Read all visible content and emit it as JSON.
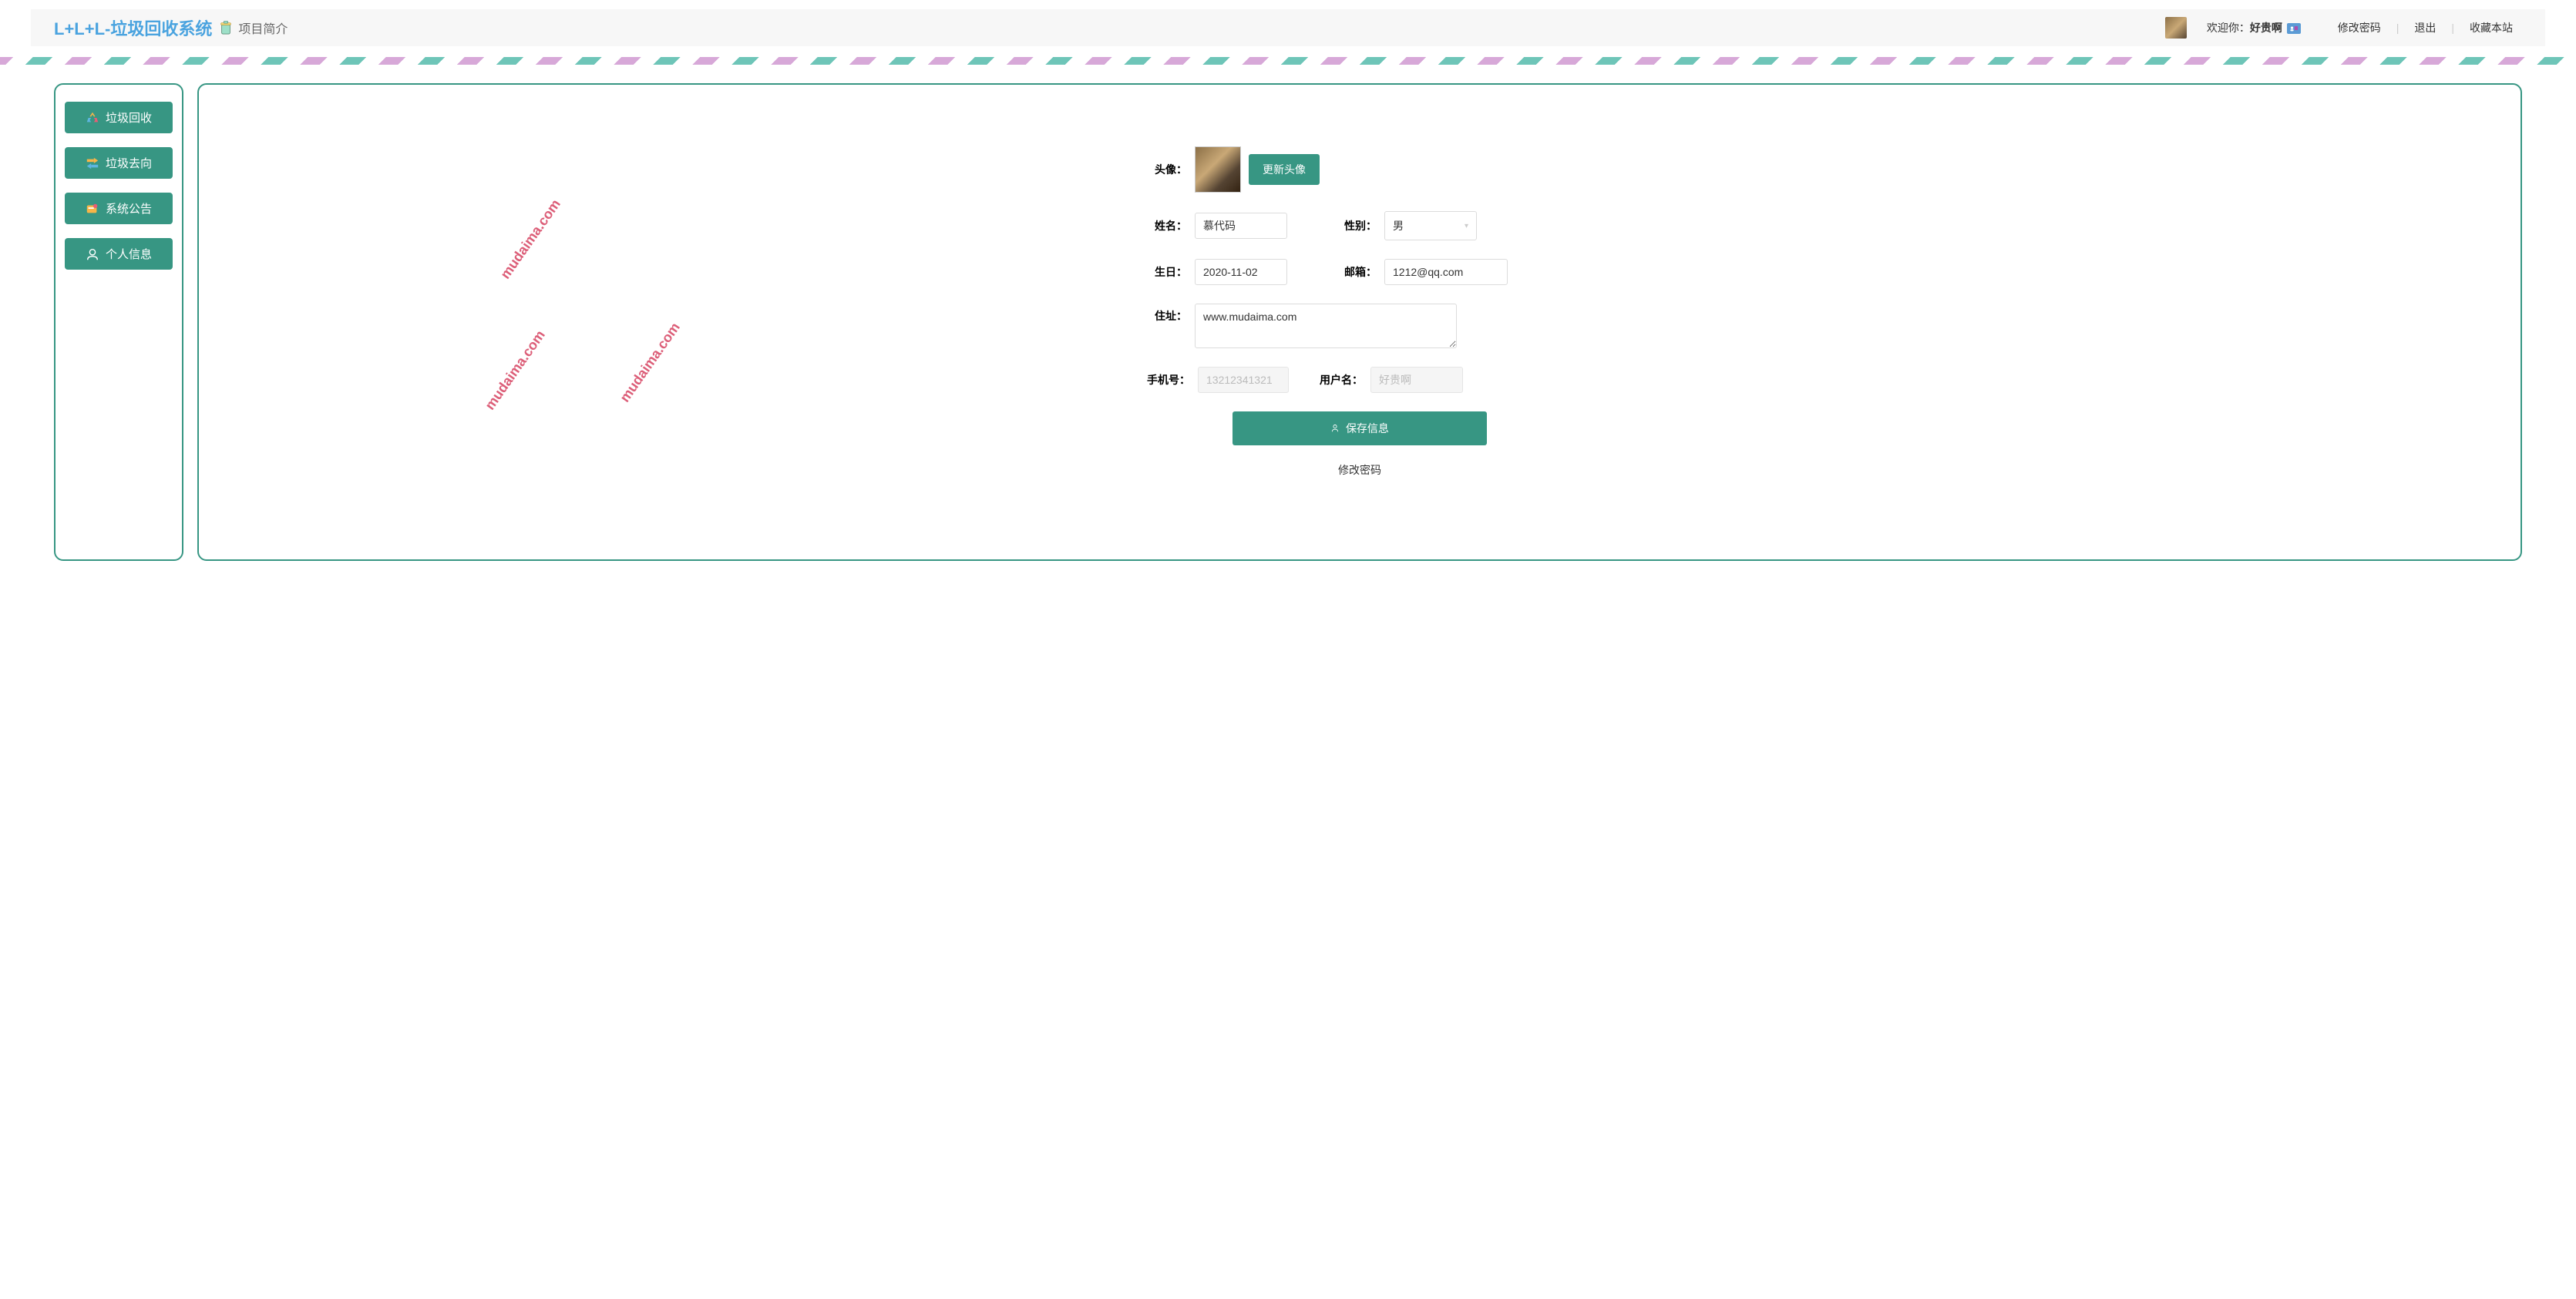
{
  "header": {
    "logo": "L+L+L-垃圾回收系统",
    "project_intro": "项目简介",
    "welcome_prefix": "欢迎你：",
    "username": "好贵啊",
    "links": {
      "change_password": "修改密码",
      "logout": "退出",
      "favorite": "收藏本站"
    },
    "divider": "|"
  },
  "sidebar": {
    "items": [
      {
        "label": "垃圾回收",
        "icon": "recycle-icon"
      },
      {
        "label": "垃圾去向",
        "icon": "direction-icon"
      },
      {
        "label": "系统公告",
        "icon": "announce-icon"
      },
      {
        "label": "个人信息",
        "icon": "user-icon"
      }
    ]
  },
  "form": {
    "avatar_label": "头像：",
    "update_avatar_btn": "更新头像",
    "name_label": "姓名：",
    "name_value": "慕代码",
    "gender_label": "性别：",
    "gender_value": "男",
    "birthday_label": "生日：",
    "birthday_value": "2020-11-02",
    "email_label": "邮箱：",
    "email_value": "1212@qq.com",
    "address_label": "住址：",
    "address_value": "www.mudaima.com",
    "phone_label": "手机号：",
    "phone_placeholder": "13212341321",
    "username_label": "用户名：",
    "username_placeholder": "好贵啊",
    "save_btn": "保存信息",
    "change_pwd_link": "修改密码"
  },
  "watermark": "mudaima.com",
  "colors": {
    "primary": "#379683",
    "logo": "#4aa3df"
  }
}
